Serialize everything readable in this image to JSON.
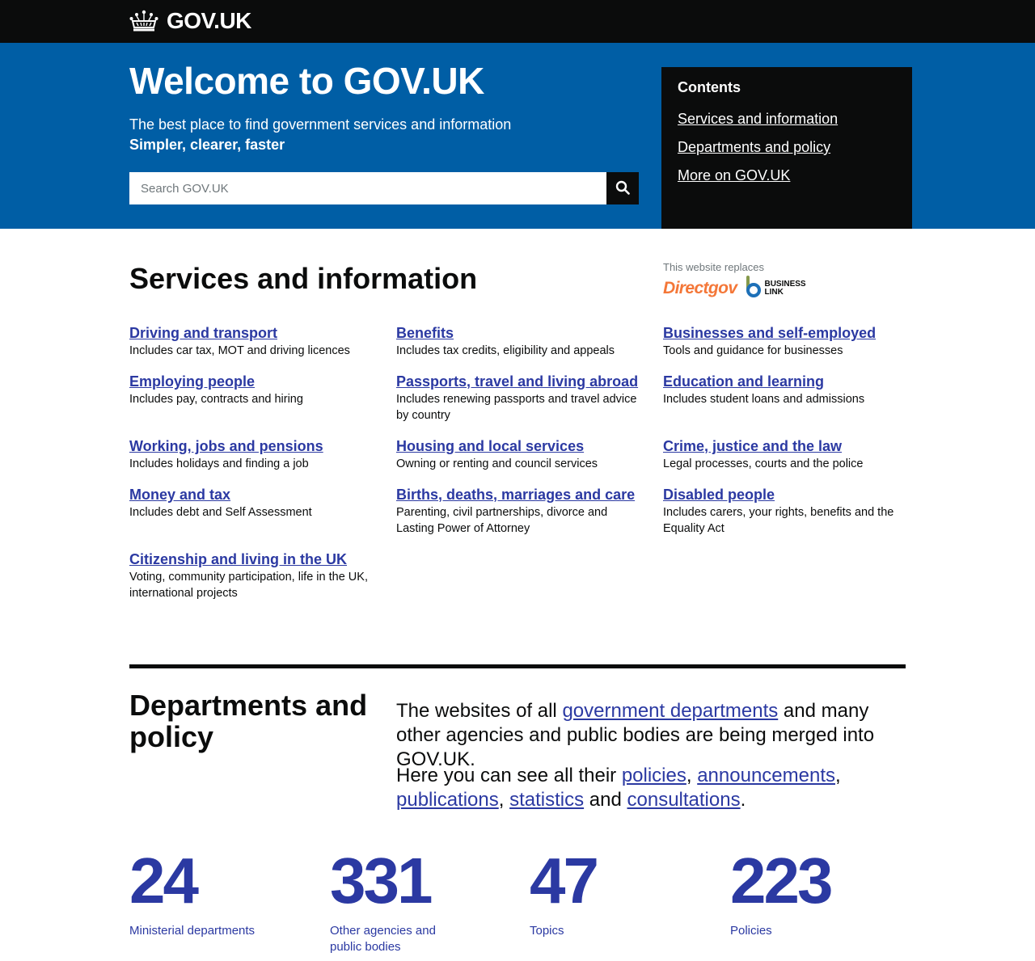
{
  "header": {
    "logo_text": "GOV.UK",
    "logo_icon": "crown-icon"
  },
  "hero": {
    "title": "Welcome to GOV.UK",
    "subtitle": "The best place to find government services and information",
    "tagline": "Simpler, clearer, faster",
    "search": {
      "placeholder": "Search GOV.UK",
      "value": "",
      "button_icon": "search-icon"
    }
  },
  "contents": {
    "title": "Contents",
    "links": [
      "Services and information",
      "Departments and policy",
      "More on GOV.UK"
    ]
  },
  "services": {
    "title": "Services and information",
    "replaces_label": "This website replaces",
    "replaces_logos": {
      "directgov": "Directgov",
      "business_link_line1": "BUSINESS",
      "business_link_line2": "LINK"
    },
    "columns": [
      [
        {
          "title": "Driving and transport",
          "desc": "Includes car tax, MOT and driving licences"
        },
        {
          "title": "Employing people",
          "desc": "Includes pay, contracts and hiring"
        },
        {
          "title": "Working, jobs and pensions",
          "desc": "Includes holidays and finding a job"
        },
        {
          "title": "Money and tax",
          "desc": "Includes debt and Self Assessment"
        },
        {
          "title": "Citizenship and living in the UK",
          "desc": "Voting, community participation, life in the UK, international projects"
        }
      ],
      [
        {
          "title": "Benefits",
          "desc": "Includes tax credits, eligibility and appeals"
        },
        {
          "title": "Passports, travel and living abroad",
          "desc": "Includes renewing passports and travel advice by country"
        },
        {
          "title": "Housing and local services",
          "desc": "Owning or renting and council services"
        },
        {
          "title": "Births, deaths, marriages and care",
          "desc": "Parenting, civil partnerships, divorce and Lasting Power of Attorney"
        }
      ],
      [
        {
          "title": "Businesses and self-employed",
          "desc": "Tools and guidance for businesses"
        },
        {
          "title": "Education and learning",
          "desc": "Includes student loans and admissions"
        },
        {
          "title": "Crime, justice and the law",
          "desc": "Legal processes, courts and the police"
        },
        {
          "title": "Disabled people",
          "desc": "Includes carers, your rights, benefits and the Equality Act"
        }
      ]
    ]
  },
  "departments": {
    "title": "Departments and policy",
    "para1": {
      "before": "The websites of all ",
      "link": "government departments",
      "after": " and many other agencies and public bodies are being merged into GOV.UK."
    },
    "para2": {
      "before": "Here you can see all their ",
      "links": [
        "policies",
        "announcements",
        "publications",
        "statistics",
        "consultations"
      ],
      "sep1": ", ",
      "sep2": ", ",
      "sep3": ", ",
      "sep4": " and ",
      "end": "."
    },
    "stats": [
      {
        "number": "24",
        "label": "Ministerial departments"
      },
      {
        "number": "331",
        "label": "Other agencies and public bodies"
      },
      {
        "number": "47",
        "label": "Topics"
      },
      {
        "number": "223",
        "label": "Policies"
      }
    ]
  },
  "colors": {
    "header_bg": "#0b0c0c",
    "hero_bg": "#005ea5",
    "link": "#2b39a2",
    "directgov_orange": "#f47738",
    "business_link_blue": "#1d70b8",
    "business_link_green": "#85994b"
  }
}
